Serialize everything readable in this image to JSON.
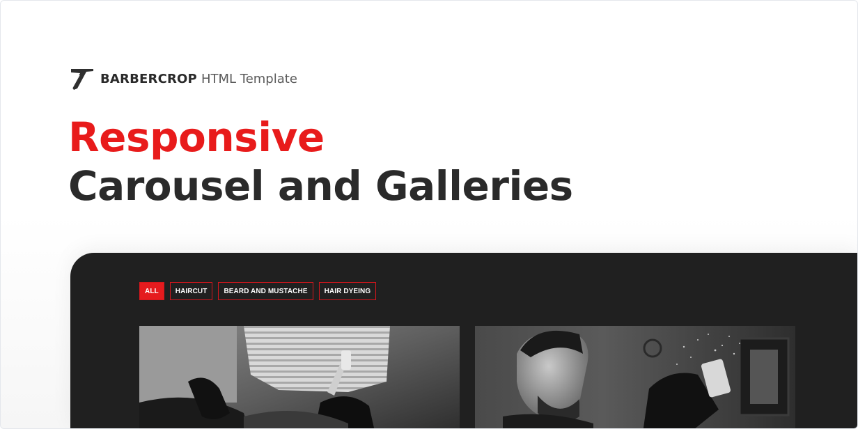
{
  "brand": {
    "name": "BARBERCROP",
    "subtitle": "HTML Template",
    "logo_icon": "straight-razor-icon"
  },
  "headline": {
    "line1": "Responsive",
    "line2": "Carousel and Galleries",
    "accent_color": "#e81b1b",
    "dark_color": "#2a2a2a"
  },
  "gallery": {
    "background": "#202020",
    "filters": [
      {
        "label": "ALL",
        "active": true
      },
      {
        "label": "HAIRCUT",
        "active": false
      },
      {
        "label": "BEARD AND MUSTACHE",
        "active": false
      },
      {
        "label": "HAIR DYEING",
        "active": false
      }
    ],
    "items": [
      {
        "icon": "barber-shaving-photo"
      },
      {
        "icon": "barber-spray-photo"
      }
    ]
  }
}
